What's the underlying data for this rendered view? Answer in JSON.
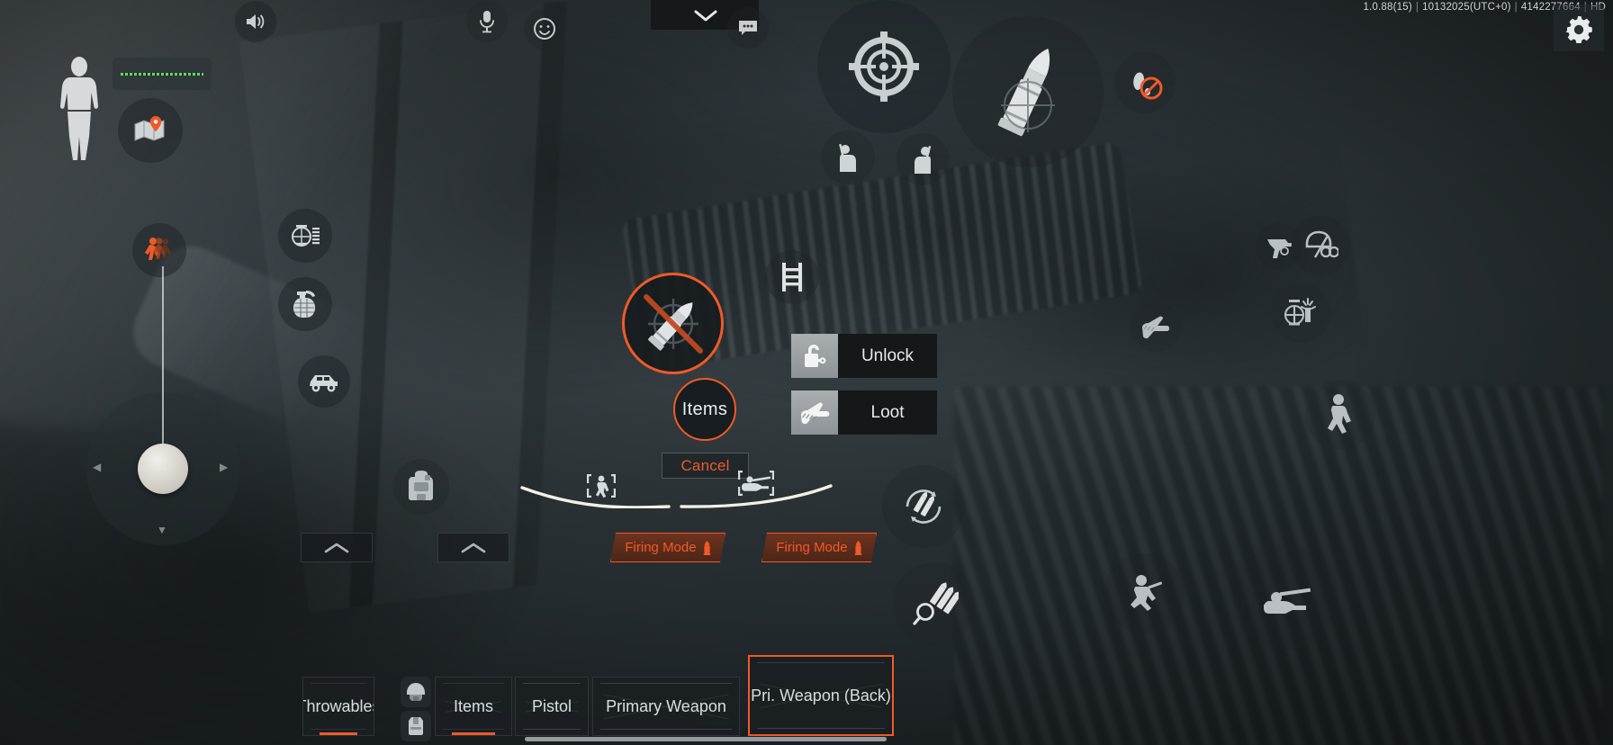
{
  "topbar": {
    "version": "1.0.88(15)",
    "build_date": "10132025(UTC+0)",
    "session_id": "4142277664",
    "quality": "HD",
    "separator": "|",
    "settings_icon": "gear-icon",
    "chat_icon": "chat-bubble-icon",
    "collapse_icon": "chevron-down-icon",
    "speaker_icon": "speaker-icon",
    "mic_icon": "microphone-icon",
    "emote_icon": "emoji-face-icon"
  },
  "left_hud": {
    "avatar_icon": "body-silhouette-icon",
    "health_label": "health-bar",
    "health_color": "#5ce05c",
    "map_icon": "map-pin-icon",
    "sprint_icon": "sprint-icon",
    "sprint_color": "#f05a28",
    "compass_icon": "compass-icon",
    "grenade_icon": "grenade-icon",
    "vehicle_icon": "vehicle-icon",
    "backpack_icon": "backpack-icon",
    "joystick_icon": "movement-joystick"
  },
  "right_hud": {
    "scope_icon": "crosshair-scope-icon",
    "ammo_icon": "bullet-icon",
    "no_shoe_icon": "silent-footsteps-icon",
    "lean_left_icon": "lean-left-icon",
    "lean_right_icon": "lean-right-icon",
    "pistol_icon": "pistol-icon",
    "helmet_goggles_icon": "helmet-goggles-icon",
    "scope_flash_icon": "scope-flash-icon",
    "soldier_run_icon": "soldier-running-icon",
    "soldier_crouch_icon": "soldier-crouching-icon",
    "soldier_prone_icon": "soldier-prone-icon",
    "reload_icon": "reload-ammo-icon",
    "ammo_search_icon": "ammo-search-icon",
    "melee_icon": "melee-hand-icon"
  },
  "radial_menu": {
    "main_action": {
      "icon": "bullet-crossed-out-icon",
      "ring_color": "#f05a28"
    },
    "items_button": {
      "label": "Items",
      "ring_color": "#f05a28"
    },
    "cancel_button": {
      "label": "Cancel",
      "text_color": "#f05a28"
    },
    "actions": [
      {
        "label": "Unlock",
        "icon": "padlock-key-icon"
      },
      {
        "label": "Loot",
        "icon": "grab-hand-icon"
      }
    ],
    "ladder_icon": "ladder-icon"
  },
  "bottom_bar": {
    "chevron_tabs": [
      {
        "icon": "chevron-up-icon"
      },
      {
        "icon": "chevron-up-icon"
      }
    ],
    "mode_tabs": [
      {
        "label": "Firing Mode",
        "icon": "bullet-small-icon",
        "selected": false
      },
      {
        "label": "Firing Mode",
        "icon": "bullet-small-icon",
        "selected": true
      }
    ],
    "slots": [
      {
        "label": "Throwables",
        "selected": false,
        "active": false
      },
      {
        "label": "Items",
        "selected": false,
        "active": true
      },
      {
        "label": "Pistol",
        "selected": false,
        "active": false
      },
      {
        "label": "Primary Weapon",
        "selected": false,
        "active": false
      },
      {
        "label": "Pri. Weapon (Back)",
        "selected": true,
        "active": false
      }
    ],
    "gear_slots": [
      {
        "icon": "helmet-icon"
      },
      {
        "icon": "vest-icon"
      }
    ],
    "scrollbar": "horizontal-scrollbar"
  },
  "arc_figures": {
    "left_icon": "soldier-standing-bracket-icon",
    "right_icon": "soldier-prone-bracket-icon"
  },
  "colors": {
    "accent": "#f05a28",
    "panel": "#151819",
    "text": "#e6eaec",
    "health": "#5ce05c"
  }
}
